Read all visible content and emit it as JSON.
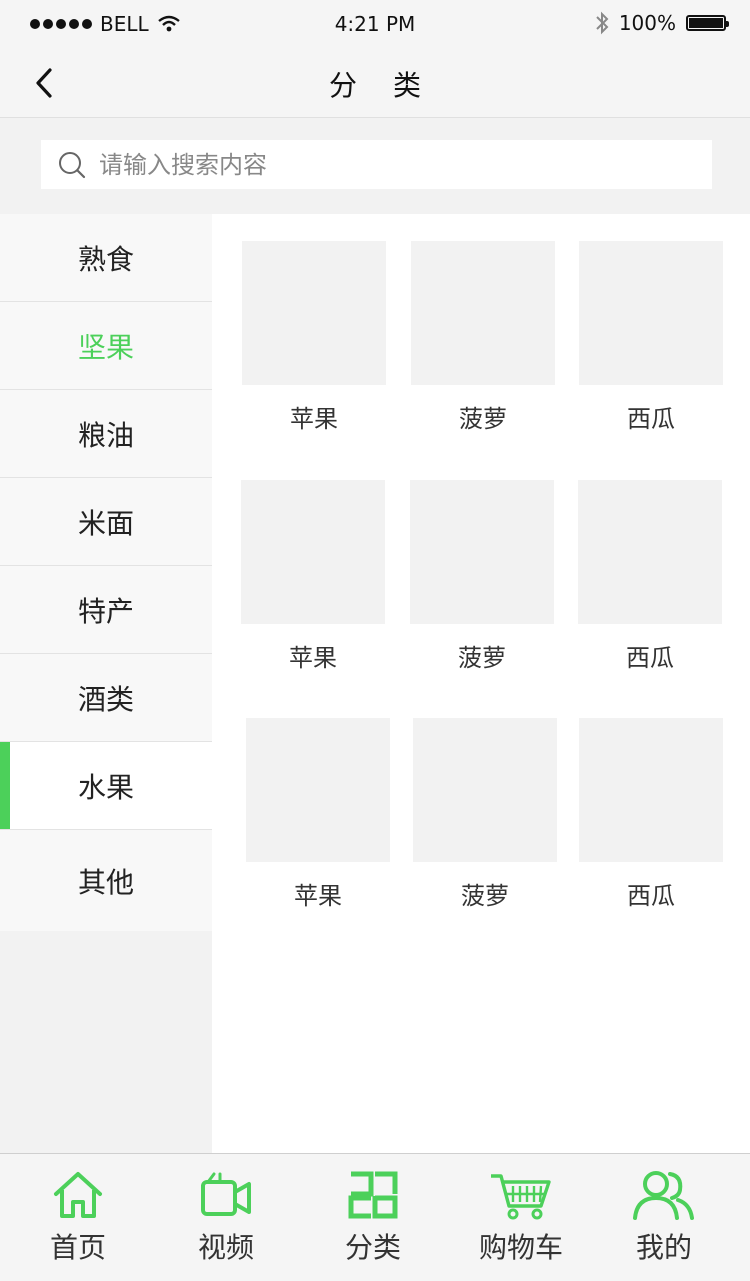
{
  "status_bar": {
    "carrier": "BELL",
    "time": "4:21 PM",
    "battery": "100%"
  },
  "navbar": {
    "title": "分类"
  },
  "search": {
    "placeholder": "请输入搜索内容"
  },
  "sidebar": {
    "items": [
      {
        "label": "熟食"
      },
      {
        "label": "坚果"
      },
      {
        "label": "粮油"
      },
      {
        "label": "米面"
      },
      {
        "label": "特产"
      },
      {
        "label": "酒类"
      },
      {
        "label": "水果"
      },
      {
        "label": "其他"
      }
    ],
    "selected": "水果"
  },
  "products": [
    {
      "name": "苹果"
    },
    {
      "name": "菠萝"
    },
    {
      "name": "西瓜"
    },
    {
      "name": "苹果"
    },
    {
      "name": "菠萝"
    },
    {
      "name": "西瓜"
    },
    {
      "name": "苹果"
    },
    {
      "name": "菠萝"
    },
    {
      "name": "西瓜"
    }
  ],
  "tabbar": {
    "items": [
      {
        "label": "首页",
        "icon": "home-icon"
      },
      {
        "label": "视频",
        "icon": "video-icon"
      },
      {
        "label": "分类",
        "icon": "category-icon"
      },
      {
        "label": "购物车",
        "icon": "cart-icon"
      },
      {
        "label": "我的",
        "icon": "user-icon"
      }
    ]
  },
  "colors": {
    "accent": "#4cd05a",
    "background": "#f2f2f2",
    "placeholder_tile": "#f2f2f2"
  }
}
